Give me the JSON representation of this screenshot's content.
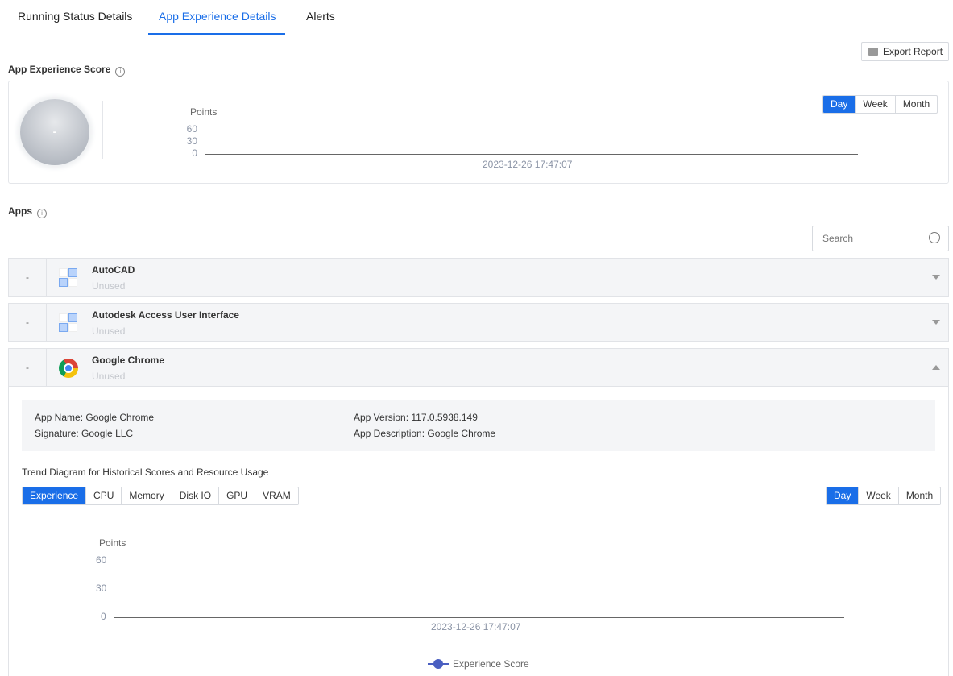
{
  "tabs": [
    {
      "label": "Running Status Details"
    },
    {
      "label": "App Experience Details"
    },
    {
      "label": "Alerts"
    }
  ],
  "toolbar": {
    "export_label": "Export Report"
  },
  "score": {
    "title": "App Experience Score",
    "value": "-",
    "chart": {
      "ylabel": "Points",
      "ticks": [
        "60",
        "30",
        "0"
      ],
      "x_label": "2023-12-26 17:47:07"
    },
    "periods": [
      "Day",
      "Week",
      "Month"
    ],
    "selected_period": "Day"
  },
  "apps": {
    "title": "Apps",
    "search_placeholder": "Search",
    "items": [
      {
        "dash": "-",
        "name": "AutoCAD",
        "status": "Unused",
        "icon": "generic-app-icon",
        "expanded": false
      },
      {
        "dash": "-",
        "name": "Autodesk Access User Interface",
        "status": "Unused",
        "icon": "generic-app-icon",
        "expanded": false
      },
      {
        "dash": "-",
        "name": "Google Chrome",
        "status": "Unused",
        "icon": "chrome-icon",
        "expanded": true
      }
    ],
    "details": {
      "app_name": "App Name: Google Chrome",
      "signature": "Signature: Google LLC",
      "app_version": "App Version: 117.0.5938.149",
      "app_description": "App Description: Google Chrome"
    },
    "trend": {
      "title": "Trend Diagram for Historical Scores and Resource Usage",
      "metrics": [
        "Experience",
        "CPU",
        "Memory",
        "Disk IO",
        "GPU",
        "VRAM"
      ],
      "selected_metric": "Experience",
      "periods": [
        "Day",
        "Week",
        "Month"
      ],
      "selected_period": "Day",
      "chart": {
        "ylabel": "Points",
        "ticks": [
          "60",
          "30",
          "0"
        ],
        "x_label": "2023-12-26 17:47:07",
        "legend": "Experience Score"
      }
    }
  }
}
